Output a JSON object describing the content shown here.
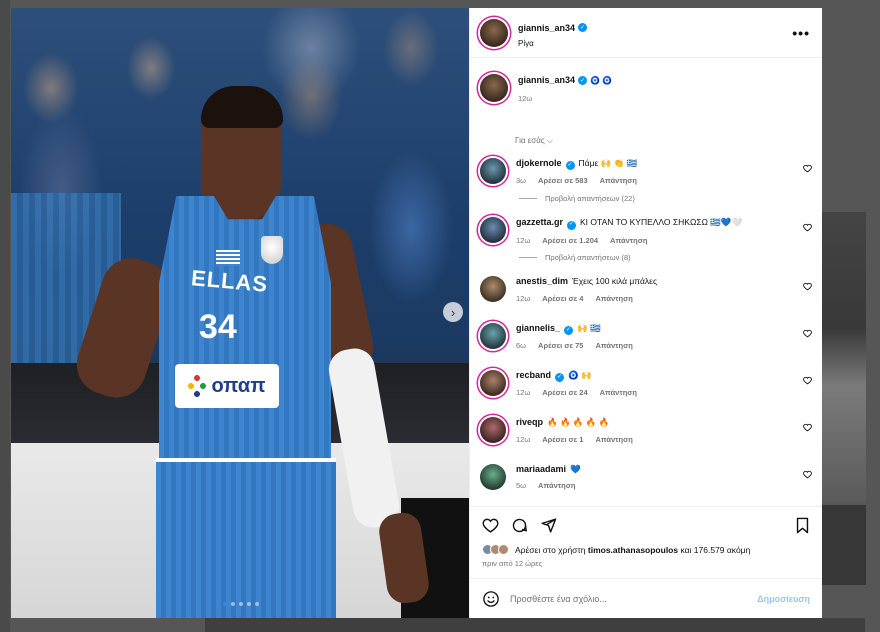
{
  "post": {
    "author": "giannis_an34",
    "location": "Ρίγα",
    "next_icon": "chevron-right-icon",
    "slides": 5,
    "active_slide": 1
  },
  "caption": {
    "user": "giannis_an34",
    "emoji": "🧿 🧿",
    "time": "12ω"
  },
  "for_you": "Για εσάς ⌵",
  "comments": [
    {
      "user": "djokernole",
      "verified": true,
      "text": "Πάμε 🙌 👏 🇬🇷",
      "time": "3ω",
      "likes": "Αρέσει σε 583",
      "reply": "Απάντηση",
      "view_replies": "Προβολή απαντήσεων (22)"
    },
    {
      "user": "gazzetta.gr",
      "verified": true,
      "text": "ΚΙ ΟΤΑΝ ΤΟ ΚΥΠΕΛΛΟ ΣΗΚΩΣΩ 🇬🇷💙🤍",
      "time": "12ω",
      "likes": "Αρέσει σε 1.204",
      "reply": "Απάντηση",
      "view_replies": "Προβολή απαντήσεων (8)"
    },
    {
      "user": "anestis_dim",
      "verified": false,
      "text": "Έχεις 100 κιλά μπάλες",
      "time": "12ω",
      "likes": "Αρέσει σε 4",
      "reply": "Απάντηση"
    },
    {
      "user": "giannelis_",
      "verified": true,
      "text": "🙌 🇬🇷",
      "time": "6ω",
      "likes": "Αρέσει σε 75",
      "reply": "Απάντηση"
    },
    {
      "user": "recband",
      "verified": true,
      "text": "🧿 🙌",
      "time": "12ω",
      "likes": "Αρέσει σε 24",
      "reply": "Απάντηση"
    },
    {
      "user": "riveqp",
      "verified": false,
      "text": "🔥 🔥 🔥 🔥 🔥",
      "time": "12ω",
      "likes": "Αρέσει σε 1",
      "reply": "Απάντηση"
    },
    {
      "user": "mariaadami",
      "verified": false,
      "text": "💙",
      "time": "5ω",
      "reply": "Απάντηση"
    }
  ],
  "actions": {
    "like_icon": "heart-icon",
    "comment_icon": "comment-icon",
    "share_icon": "send-icon",
    "save_icon": "bookmark-icon"
  },
  "likes_line": {
    "prefix": "Αρέσει στο χρήστη",
    "user": "timos.athanasopoulos",
    "suffix": "και 176.579 ακόμη"
  },
  "posted": "πριν από 12 ώρες",
  "add_comment": {
    "placeholder": "Προσθέστε ένα σχόλιο...",
    "publish": "Δημοσίευση",
    "emoji_icon": "smiley-icon"
  },
  "colors": {
    "verified": "#0095f6",
    "publish": "#9bc5ee",
    "story_ring": "#d6249f",
    "jersey": "#3d86cf"
  }
}
